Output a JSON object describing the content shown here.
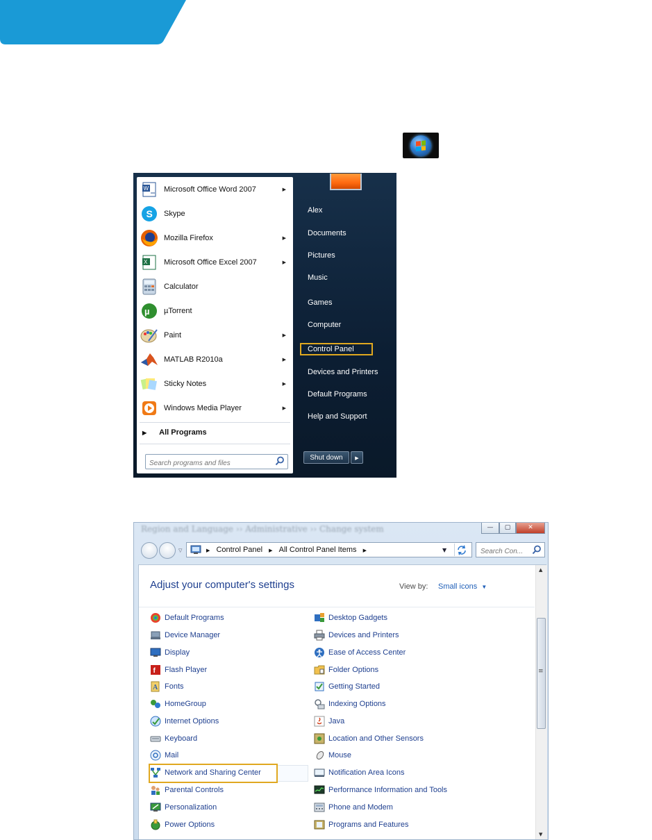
{
  "colors": {
    "banner": "#1a9ad6",
    "highlight": "#e0a820",
    "cp_link": "#1e3f8f"
  },
  "start_button": {
    "icon": "windows-orb-icon"
  },
  "start_menu": {
    "programs": [
      {
        "label": "Microsoft Office Word 2007",
        "icon": "word-icon",
        "has_submenu": true
      },
      {
        "label": "Skype",
        "icon": "skype-icon",
        "has_submenu": false
      },
      {
        "label": "Mozilla Firefox",
        "icon": "firefox-icon",
        "has_submenu": true
      },
      {
        "label": "Microsoft Office Excel 2007",
        "icon": "excel-icon",
        "has_submenu": true
      },
      {
        "label": "Calculator",
        "icon": "calculator-icon",
        "has_submenu": false
      },
      {
        "label": "µTorrent",
        "icon": "utorrent-icon",
        "has_submenu": false
      },
      {
        "label": "Paint",
        "icon": "paint-icon",
        "has_submenu": true
      },
      {
        "label": "MATLAB R2010a",
        "icon": "matlab-icon",
        "has_submenu": true
      },
      {
        "label": "Sticky Notes",
        "icon": "sticky-notes-icon",
        "has_submenu": true
      },
      {
        "label": "Windows Media Player",
        "icon": "media-player-icon",
        "has_submenu": true
      }
    ],
    "all_programs": "All Programs",
    "search_placeholder": "Search programs and files",
    "right_items": [
      "Alex",
      "Documents",
      "Pictures",
      "Music",
      "Games",
      "Computer",
      "Control Panel",
      "Devices and Printers",
      "Default Programs",
      "Help and Support"
    ],
    "highlighted_item": "Control Panel",
    "shutdown_label": "Shut down"
  },
  "control_panel": {
    "breadcrumb": [
      "Control Panel",
      "All Control Panel Items"
    ],
    "search_placeholder": "Search Con...",
    "heading": "Adjust your computer's settings",
    "view_by_label": "View by:",
    "view_by_value": "Small icons",
    "left_items": [
      "Default Programs",
      "Device Manager",
      "Display",
      "Flash Player",
      "Fonts",
      "HomeGroup",
      "Internet Options",
      "Keyboard",
      "Mail",
      "Network and Sharing Center",
      "Parental Controls",
      "Personalization",
      "Power Options"
    ],
    "right_items": [
      "Desktop Gadgets",
      "Devices and Printers",
      "Ease of Access Center",
      "Folder Options",
      "Getting Started",
      "Indexing Options",
      "Java",
      "Location and Other Sensors",
      "Mouse",
      "Notification Area Icons",
      "Performance Information and Tools",
      "Phone and Modem",
      "Programs and Features"
    ],
    "highlighted_item": "Network and Sharing Center"
  }
}
